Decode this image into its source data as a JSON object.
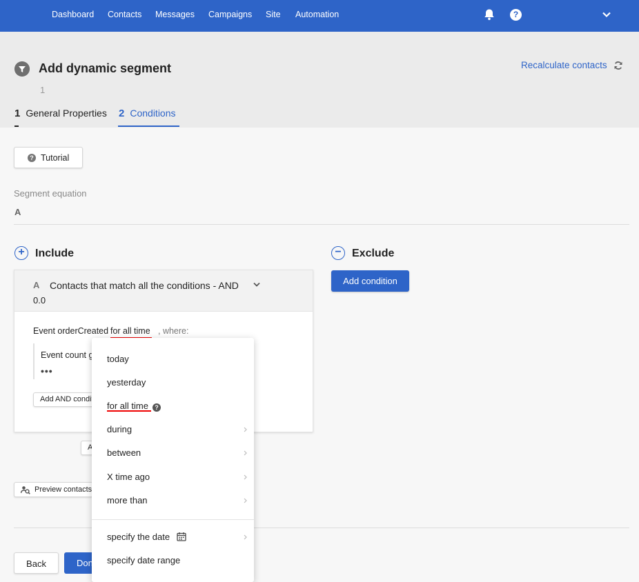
{
  "nav": {
    "items": [
      "Dashboard",
      "Contacts",
      "Messages",
      "Campaigns",
      "Site",
      "Automation"
    ],
    "icons": [
      "bell-icon",
      "help-icon",
      "chevron-down-icon"
    ]
  },
  "header": {
    "title": "Add dynamic segment",
    "subtitle": "1",
    "recalculate": "Recalculate contacts",
    "tabs": [
      {
        "num": "1",
        "label": "General Properties"
      },
      {
        "num": "2",
        "label": "Conditions"
      }
    ]
  },
  "content": {
    "tutorial": "Tutorial",
    "tutorial_icon": "?",
    "segment_label": "Segment equation",
    "segment_value": "A",
    "include_title": "Include",
    "exclude_title": "Exclude",
    "add_condition": "Add condition",
    "group": {
      "letter": "A",
      "title": "Contacts that match all the conditions - AND",
      "number": "0.0",
      "event_prefix": "Event orderCreated",
      "event_period": "for all time",
      "event_suffix": ", where:",
      "event_count": "Event count g",
      "dots": "•••",
      "add_and": "Add AND conditi"
    },
    "small_button": "A",
    "preview": "Preview contacts",
    "back": "Back",
    "done": "Done"
  },
  "dropdown": {
    "items": [
      {
        "label": "today"
      },
      {
        "label": "yesterday"
      },
      {
        "label": "for all time",
        "help": "?"
      },
      {
        "label": "during"
      },
      {
        "label": "between"
      },
      {
        "label": "X time ago"
      },
      {
        "label": "more than"
      },
      {
        "label": "specify the date"
      },
      {
        "label": "specify date range"
      }
    ]
  },
  "colors": {
    "primary": "#2e64c8",
    "underline_red": "#e00000"
  }
}
